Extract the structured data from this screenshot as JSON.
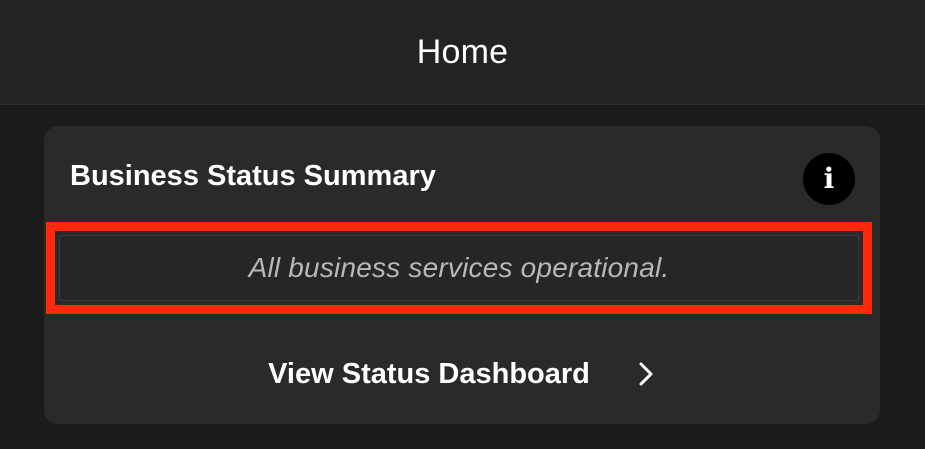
{
  "nav": {
    "title": "Home"
  },
  "card": {
    "title": "Business Status Summary",
    "info_icon": "info-icon",
    "info_glyph": "i",
    "status_message": "All business services operational.",
    "dashboard_link_label": "View Status Dashboard",
    "dashboard_link_icon": "chevron-right-icon"
  },
  "colors": {
    "background": "#1b1b1b",
    "nav_background": "#232323",
    "card_background": "#2a2a2a",
    "highlight_border": "#ff2a0c",
    "primary_text": "#ffffff",
    "secondary_text": "#b8b8b8"
  }
}
